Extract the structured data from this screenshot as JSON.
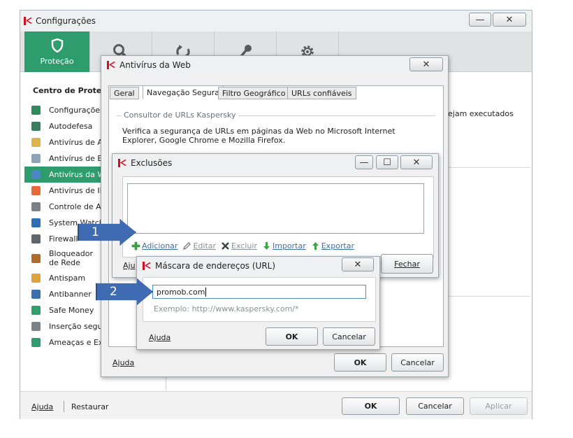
{
  "main": {
    "title": "Configurações",
    "min_btn": "—",
    "close_btn": "✕",
    "toolbar": {
      "protection_label": "Proteção",
      "tabs": [
        "search-icon",
        "update-icon",
        "key-icon",
        "gear-icon"
      ]
    },
    "sidebar": {
      "heading": "Centro de Proteç",
      "items": [
        {
          "label": "Configurações",
          "icon": "shield-icon",
          "color": "#2d8a5a"
        },
        {
          "label": "Autodefesa",
          "icon": "k-shield-icon",
          "color": "#3a7c5c"
        },
        {
          "label": "Antivírus de Ar",
          "icon": "folder-icon",
          "color": "#e0b24a"
        },
        {
          "label": "Antivírus de Em",
          "icon": "mail-icon",
          "color": "#8fa3b8"
        },
        {
          "label": "Antivírus da We",
          "icon": "globe-icon",
          "color": "#4a86c8",
          "selected": true
        },
        {
          "label": "Antivírus de IM",
          "icon": "chat-icon",
          "color": "#e86a3a"
        },
        {
          "label": "Controle de Ap",
          "icon": "filter-icon",
          "color": "#7a8288"
        },
        {
          "label": "System Watche",
          "icon": "monitor-icon",
          "color": "#2c6fb5"
        },
        {
          "label": "Firewall",
          "icon": "firewall-icon",
          "color": "#5e676c"
        },
        {
          "label": "Bloqueador de Rede",
          "icon": "network-block-icon",
          "color": "#b06a2a"
        },
        {
          "label": "Antispam",
          "icon": "antispam-icon",
          "color": "#e0a23a"
        },
        {
          "label": "Antibanner",
          "icon": "antibanner-icon",
          "color": "#3b6fb0"
        },
        {
          "label": "Safe Money",
          "icon": "money-icon",
          "color": "#2fa06a"
        },
        {
          "label": "Inserção segur",
          "icon": "keyboard-icon",
          "color": "#7a8288"
        },
        {
          "label": "Ameaças e Exc",
          "icon": "check-icon",
          "color": "#2f9c6e"
        }
      ]
    },
    "right_text": "ejam executados",
    "footer": {
      "help": "Ajuda",
      "restore": "Restaurar",
      "ok": "OK",
      "cancel": "Cancelar",
      "apply": "Aplicar"
    }
  },
  "web_dialog": {
    "title": "Antivírus da Web",
    "close_btn": "✕",
    "tabs": [
      "Geral",
      "Navegação Segura",
      "Filtro Geográfico",
      "URLs confiáveis"
    ],
    "section_title": "Consultor de URLs Kaspersky",
    "description": "Verifica a segurança de URLs em páginas da Web no Microsoft Internet Explorer, Google Chrome e Mozilla Firefox.",
    "help": "Ajuda",
    "ok": "OK",
    "cancel": "Cancelar"
  },
  "exclusions_dialog": {
    "title": "Exclusões",
    "min_btn": "—",
    "max_btn": "☐",
    "close_btn": "✕",
    "actions": {
      "add": "Adicionar",
      "edit": "Editar",
      "delete": "Excluir",
      "import": "Importar",
      "export": "Exportar"
    },
    "help_partial": "Aju",
    "close_label": "Fechar"
  },
  "mask_dialog": {
    "title": "Máscara de endereços (URL)",
    "close_btn": "✕",
    "input_value": "promob.com",
    "example": "Exemplo: http://www.kaspersky.com/*",
    "help": "Ajuda",
    "ok": "OK",
    "cancel": "Cancelar"
  },
  "callouts": {
    "one": "1",
    "two": "2"
  }
}
